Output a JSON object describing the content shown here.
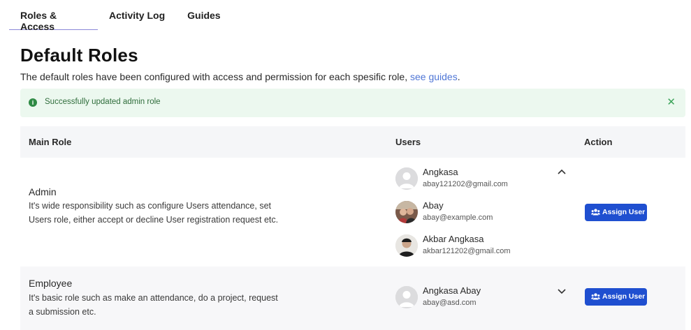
{
  "tabs": [
    {
      "label": "Roles & Access",
      "active": true
    },
    {
      "label": "Activity Log",
      "active": false
    },
    {
      "label": "Guides",
      "active": false
    }
  ],
  "page": {
    "title": "Default Roles",
    "subtitle": "The default roles have been configured with access and permission for each spesific role, ",
    "subtitle_link": "see guides",
    "subtitle_end": "."
  },
  "alert": {
    "message": "Successfully updated admin role",
    "icon": "info-icon",
    "close_icon": "close-icon",
    "color": "#2e8a44"
  },
  "table": {
    "headers": {
      "role": "Main Role",
      "users": "Users",
      "action": "Action"
    },
    "rows": [
      {
        "role": "Admin",
        "description": "It's wide responsibility such as configure Users attendance, set Users role, either accept or decline User registration request etc.",
        "expanded": true,
        "users": [
          {
            "name": "Angkasa",
            "email": "abay121202@gmail.com",
            "avatar": "placeholder"
          },
          {
            "name": "Abay",
            "email": "abay@example.com",
            "avatar": "photo"
          },
          {
            "name": "Akbar Angkasa",
            "email": "akbar121202@gmail.com",
            "avatar": "photo"
          }
        ],
        "action_label": "Assign User"
      },
      {
        "role": "Employee",
        "description": "It's basic role such as make an attendance, do a project, request a submission etc.",
        "expanded": false,
        "users": [
          {
            "name": "Angkasa Abay",
            "email": "abay@asd.com",
            "avatar": "placeholder"
          }
        ],
        "action_label": "Assign User"
      }
    ]
  },
  "colors": {
    "accent": "#1f4fd0",
    "link": "#4f76d6",
    "alert_bg": "#ecf8ef",
    "tab_underline": "#8b88d8"
  }
}
